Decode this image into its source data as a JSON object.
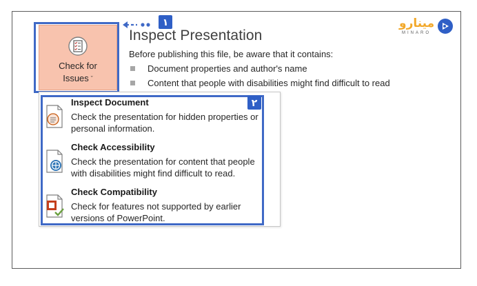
{
  "check_button": {
    "line1": "Check for",
    "line2": "Issues",
    "chevron": "ˇ"
  },
  "inspect": {
    "title": "Inspect Presentation",
    "intro": "Before publishing this file, be aware that it contains:",
    "bullets": [
      "Document properties and author's name",
      "Content that people with disabilities might find difficult to read"
    ]
  },
  "menu": {
    "items": [
      {
        "title": "Inspect Document",
        "description": "Check the presentation for hidden properties or personal information.",
        "icon": "inspect-document-icon"
      },
      {
        "title": "Check Accessibility",
        "description": "Check the presentation for content that people with disabilities might find difficult to read.",
        "icon": "accessibility-icon"
      },
      {
        "title": "Check Compatibility",
        "description": "Check for features not supported by earlier versions of PowerPoint.",
        "icon": "compatibility-icon"
      }
    ]
  },
  "annotations": {
    "badge1": "١",
    "badge2": "٢"
  },
  "logo": {
    "text": "مینارو",
    "subtext": "MINARO"
  },
  "colors": {
    "highlight_border": "#3f69c6",
    "button_bg": "#f8c3ae",
    "badge_bg": "#2f5fc6",
    "logo_orange": "#f2a82a",
    "logo_blue": "#2f5fc6"
  }
}
